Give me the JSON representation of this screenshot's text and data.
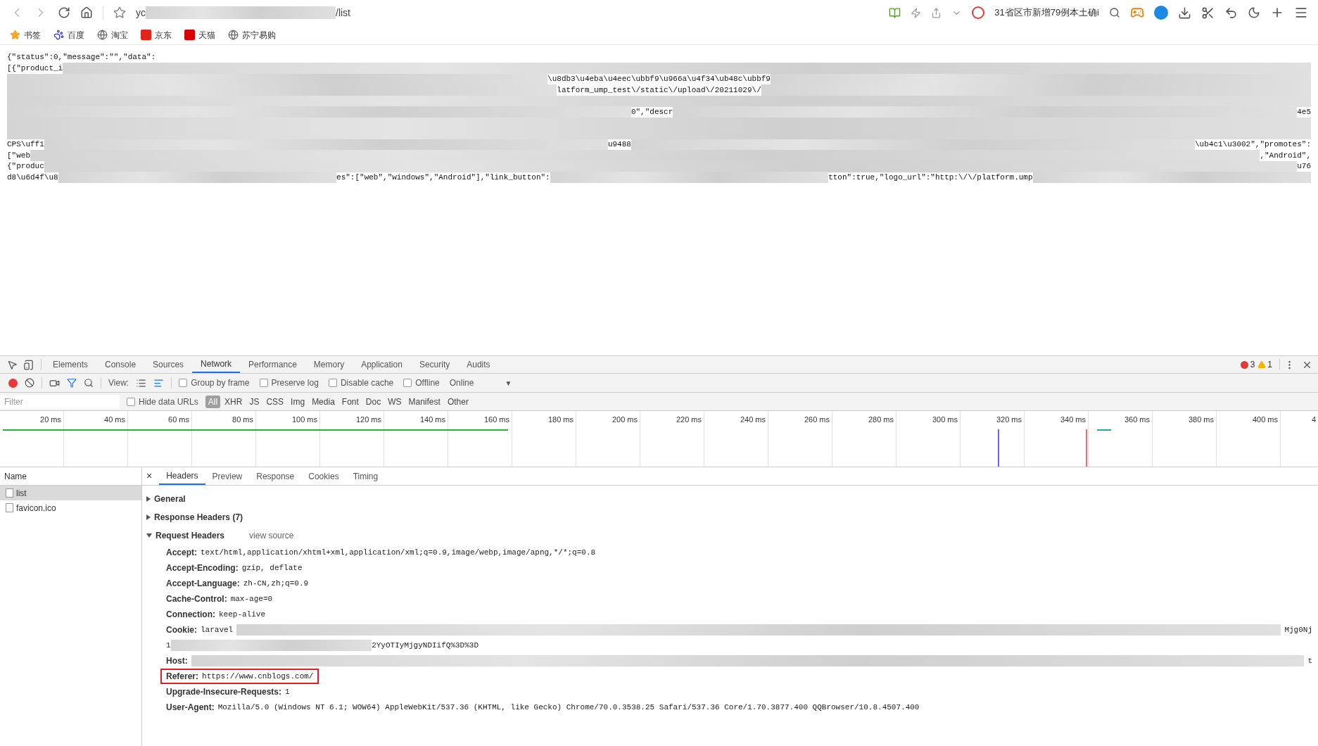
{
  "browser": {
    "address": {
      "start": "yc",
      "end": "/list"
    },
    "news": "31省区市新增79例本土确i",
    "bookmarks": [
      {
        "label": "书签"
      },
      {
        "label": "百度"
      },
      {
        "label": "淘宝"
      },
      {
        "label": "京东"
      },
      {
        "label": "天猫"
      },
      {
        "label": "苏宁易购"
      }
    ]
  },
  "page_lines": [
    [
      {
        "kind": "text",
        "text": "{\"status\":0,\"message\":\"\",\"data\":"
      }
    ],
    [
      {
        "kind": "text",
        "text": "[{\"product_i"
      },
      {
        "kind": "blur"
      }
    ],
    [
      {
        "kind": "blur"
      },
      {
        "kind": "text",
        "text": "\\u8db3\\u4eba\\u4eec\\ubbf9\\u966a\\u4f34\\ub48c\\ubbf9"
      },
      {
        "kind": "blur"
      }
    ],
    [
      {
        "kind": "blur"
      },
      {
        "kind": "text",
        "text": "latform_ump_test\\/static\\/upload\\/20211029\\/"
      },
      {
        "kind": "blur"
      }
    ],
    [
      {
        "kind": "blur"
      }
    ],
    [
      {
        "kind": "blur"
      },
      {
        "kind": "text",
        "text": "0\",\"descr"
      },
      {
        "kind": "blur"
      },
      {
        "kind": "text",
        "text": "4e5"
      }
    ],
    [
      {
        "kind": "blur"
      }
    ],
    [
      {
        "kind": "blur"
      }
    ],
    [
      {
        "kind": "text",
        "text": "CPS\\uff1"
      },
      {
        "kind": "blur"
      },
      {
        "kind": "text",
        "text": "u9488"
      },
      {
        "kind": "blur"
      },
      {
        "kind": "text",
        "text": "\\ub4c1\\u3002\",\"promotes\":"
      }
    ],
    [
      {
        "kind": "text",
        "text": "[\"web"
      },
      {
        "kind": "blur"
      },
      {
        "kind": "text",
        "text": ",\"Android\","
      }
    ],
    [
      {
        "kind": "text",
        "text": "{\"produc"
      },
      {
        "kind": "blur"
      },
      {
        "kind": "text",
        "text": "u76"
      }
    ],
    [
      {
        "kind": "text",
        "text": "d8\\u6d4f\\u8"
      },
      {
        "kind": "blur"
      },
      {
        "kind": "text",
        "text": "es\":[\"web\",\"windows\",\"Android\"],\"link_button\":"
      },
      {
        "kind": "blur"
      },
      {
        "kind": "text",
        "text": "tton\":true,\"logo_url\":\"http:\\/\\/platform.ump"
      },
      {
        "kind": "blur"
      }
    ]
  ],
  "devtools": {
    "tabs": [
      {
        "label": "Elements",
        "selected": false
      },
      {
        "label": "Console",
        "selected": false
      },
      {
        "label": "Sources",
        "selected": false
      },
      {
        "label": "Network",
        "selected": true
      },
      {
        "label": "Performance",
        "selected": false
      },
      {
        "label": "Memory",
        "selected": false
      },
      {
        "label": "Application",
        "selected": false
      },
      {
        "label": "Security",
        "selected": false
      },
      {
        "label": "Audits",
        "selected": false
      }
    ],
    "errors": "3",
    "warnings": "1",
    "toolbar": {
      "recording": true,
      "view_label": "View:",
      "options": [
        {
          "label": "Group by frame",
          "checked": false
        },
        {
          "label": "Preserve log",
          "checked": false
        },
        {
          "label": "Disable cache",
          "checked": false
        },
        {
          "label": "Offline",
          "checked": false
        }
      ],
      "throttling": "Online",
      "caret": "▼"
    },
    "filter": {
      "placeholder": "Filter",
      "hide_data_urls": {
        "label": "Hide data URLs",
        "checked": false
      },
      "types": [
        {
          "label": "All",
          "selected": true
        },
        {
          "label": "XHR",
          "selected": false
        },
        {
          "label": "JS",
          "selected": false
        },
        {
          "label": "CSS",
          "selected": false
        },
        {
          "label": "Img",
          "selected": false
        },
        {
          "label": "Media",
          "selected": false
        },
        {
          "label": "Font",
          "selected": false
        },
        {
          "label": "Doc",
          "selected": false
        },
        {
          "label": "WS",
          "selected": false
        },
        {
          "label": "Manifest",
          "selected": false
        },
        {
          "label": "Other",
          "selected": false
        }
      ]
    },
    "timeline_ticks": [
      "20 ms",
      "40 ms",
      "60 ms",
      "80 ms",
      "100 ms",
      "120 ms",
      "140 ms",
      "160 ms",
      "180 ms",
      "200 ms",
      "220 ms",
      "240 ms",
      "260 ms",
      "280 ms",
      "300 ms",
      "320 ms",
      "340 ms",
      "360 ms",
      "380 ms",
      "400 ms",
      "4"
    ],
    "requests": {
      "header": "Name",
      "items": [
        {
          "name": "list",
          "selected": true
        },
        {
          "name": "favicon.ico",
          "selected": false
        }
      ]
    },
    "detail_close": "×",
    "detail_tabs": [
      {
        "label": "Headers",
        "selected": true
      },
      {
        "label": "Preview",
        "selected": false
      },
      {
        "label": "Response",
        "selected": false
      },
      {
        "label": "Cookies",
        "selected": false
      },
      {
        "label": "Timing",
        "selected": false
      }
    ],
    "sections": [
      {
        "title": "General",
        "expanded": false
      },
      {
        "title": "Response Headers (7)",
        "expanded": false
      },
      {
        "title": "Request Headers",
        "expanded": true,
        "link": "view source"
      }
    ],
    "request_headers": [
      {
        "name": "Accept:",
        "value": [
          {
            "kind": "text",
            "text": "text/html,application/xhtml+xml,application/xml;q=0.9,image/webp,image/apng,*/*;q=0.8"
          }
        ],
        "highlighted": false
      },
      {
        "name": "Accept-Encoding:",
        "value": [
          {
            "kind": "text",
            "text": "gzip, deflate"
          }
        ],
        "highlighted": false
      },
      {
        "name": "Accept-Language:",
        "value": [
          {
            "kind": "text",
            "text": "zh-CN,zh;q=0.9"
          }
        ],
        "highlighted": false
      },
      {
        "name": "Cache-Control:",
        "value": [
          {
            "kind": "text",
            "text": "max-age=0"
          }
        ],
        "highlighted": false
      },
      {
        "name": "Connection:",
        "value": [
          {
            "kind": "text",
            "text": "keep-alive"
          }
        ],
        "highlighted": false
      },
      {
        "name": "Cookie:",
        "value": [
          {
            "kind": "text",
            "text": "laravel"
          },
          {
            "kind": "blur"
          },
          {
            "kind": "text",
            "text": "Mjg0Nj"
          }
        ],
        "continuation": [
          {
            "kind": "text",
            "text": "1"
          },
          {
            "kind": "blur"
          },
          {
            "kind": "text",
            "text": "2YyOTIyMjgyNDIifQ%3D%3D"
          }
        ],
        "highlighted": false
      },
      {
        "name": "Host:",
        "value": [
          {
            "kind": "blur"
          },
          {
            "kind": "text",
            "text": "t"
          }
        ],
        "highlighted": false
      },
      {
        "name": "Referer:",
        "value": [
          {
            "kind": "text",
            "text": "https://www.cnblogs.com/"
          }
        ],
        "highlighted": true
      },
      {
        "name": "Upgrade-Insecure-Requests:",
        "value": [
          {
            "kind": "text",
            "text": "1"
          }
        ],
        "highlighted": false
      },
      {
        "name": "User-Agent:",
        "value": [
          {
            "kind": "text",
            "text": "Mozilla/5.0 (Windows NT 6.1; WOW64) AppleWebKit/537.36 (KHTML, like Gecko) Chrome/70.0.3538.25 Safari/537.36 Core/1.70.3877.400 QQBrowser/10.8.4507.400"
          }
        ],
        "highlighted": false
      }
    ]
  }
}
